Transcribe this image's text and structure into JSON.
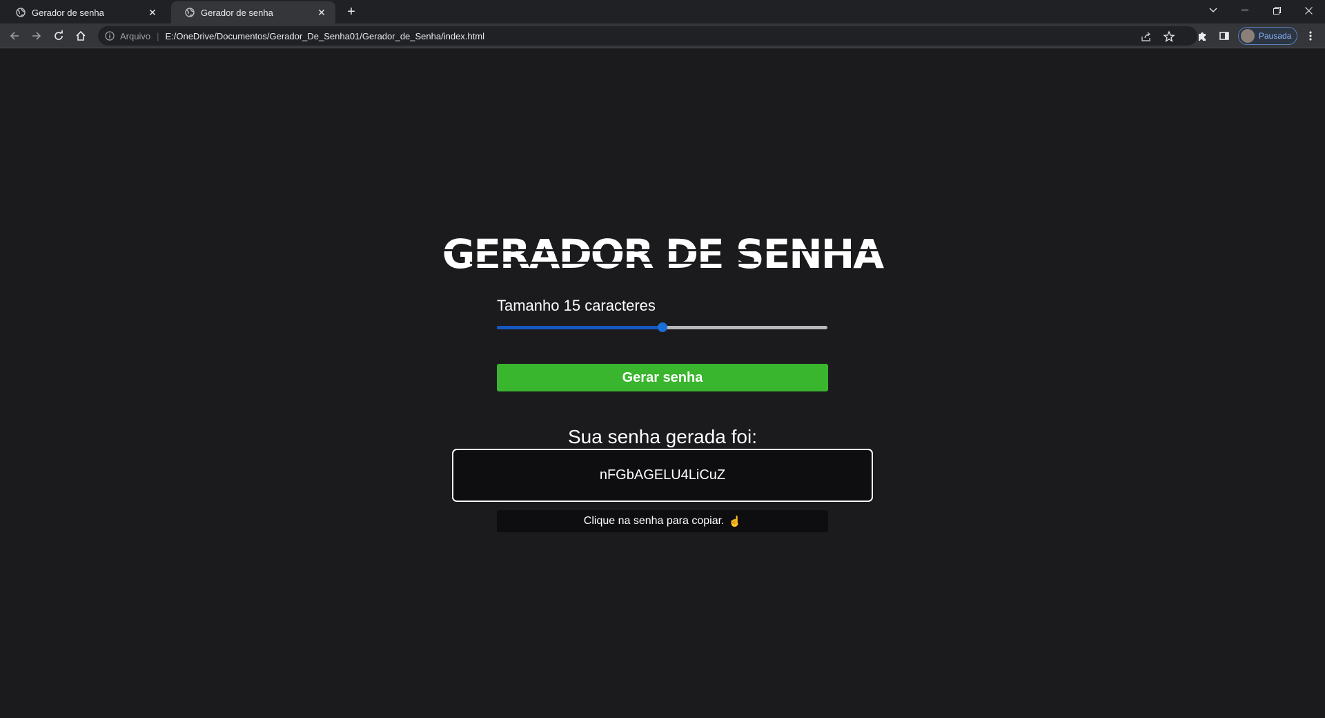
{
  "browser": {
    "tabs": [
      {
        "title": "Gerador de senha",
        "active": false
      },
      {
        "title": "Gerador de senha",
        "active": true
      }
    ],
    "new_tab_label": "+",
    "address": {
      "scheme_label": "Arquivo",
      "url": "E:/OneDrive/Documentos/Gerador_De_Senha01/Gerador_de_Senha/index.html"
    },
    "profile_label": "Pausada",
    "colors": {
      "tabstrip": "#202124",
      "toolbar": "#35363a",
      "omnibox": "#202124"
    }
  },
  "app": {
    "title": "GERADOR DE SENHA",
    "length_label": "Tamanho 15 caracteres",
    "slider": {
      "value": 15,
      "fraction": 0.5
    },
    "generate_button": "Gerar senha",
    "result_label": "Sua senha gerada foi:",
    "password": "nFGbAGELU4LiCuZ",
    "copy_hint": "Clique na senha para copiar.",
    "copy_hint_icon": "pointing-hand-icon",
    "colors": {
      "background": "#1b1b1e",
      "button": "#3ab52e",
      "slider_fill": "#1558c0",
      "box": "#0e0e10"
    }
  }
}
